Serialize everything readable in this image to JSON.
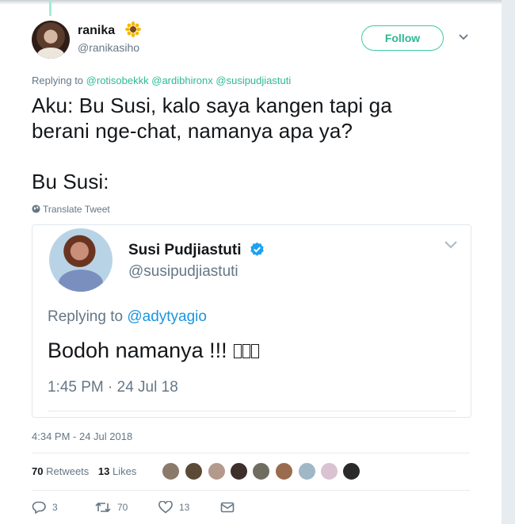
{
  "author": {
    "name": "ranika",
    "emoji": "sunflower-icon",
    "handle": "@ranikasiho",
    "follow_label": "Follow"
  },
  "reply": {
    "prefix": "Replying to",
    "mentions": [
      "@rotisobekkk",
      "@ardibhironx",
      "@susipudjiastuti"
    ]
  },
  "tweet": {
    "line1": "Aku: Bu Susi, kalo saya kangen tapi ga",
    "line2": "berani nge-chat, namanya apa ya?",
    "line3": "Bu Susi:",
    "translate_label": "Translate Tweet"
  },
  "quoted": {
    "name": "Susi Pudjiastuti",
    "handle": "@susipudjiastuti",
    "reply_prefix": "Replying to",
    "reply_mention": "@adytyagio",
    "text": "Bodoh namanya !!!",
    "time": "1:45 PM · 24 Jul 18"
  },
  "timestamp": "4:34 PM - 24 Jul 2018",
  "stats": {
    "retweets_count": "70",
    "retweets_label": "Retweets",
    "likes_count": "13",
    "likes_label": "Likes"
  },
  "actions": {
    "reply_count": "3",
    "retweet_count": "70",
    "like_count": "13"
  },
  "colors": {
    "accent": "#2eb894",
    "link": "#1b95e0",
    "muted": "#657786"
  }
}
